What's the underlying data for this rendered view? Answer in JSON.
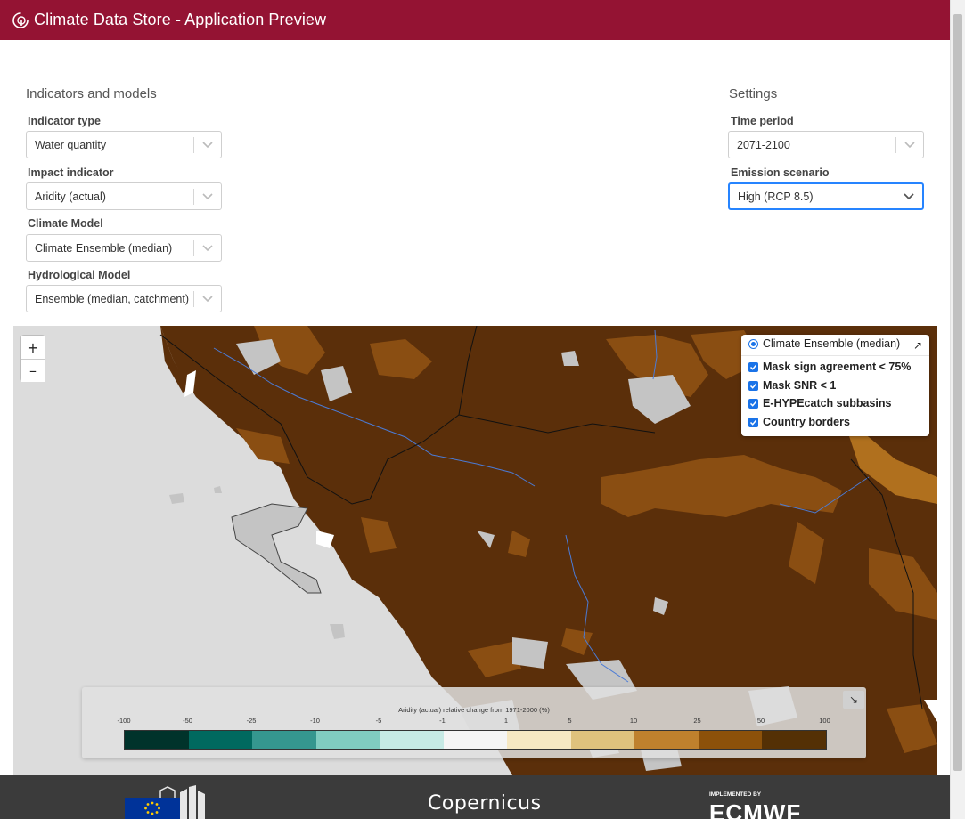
{
  "header": {
    "title": "Climate Data Store - Application Preview"
  },
  "indicators": {
    "section_title": "Indicators and models",
    "indicator_type": {
      "label": "Indicator type",
      "value": "Water quantity"
    },
    "impact_indicator": {
      "label": "Impact indicator",
      "value": "Aridity (actual)"
    },
    "climate_model": {
      "label": "Climate Model",
      "value": "Climate Ensemble (median)"
    },
    "hydrological_model": {
      "label": "Hydrological Model",
      "value": "Ensemble (median, catchment)"
    }
  },
  "settings": {
    "section_title": "Settings",
    "time_period": {
      "label": "Time period",
      "value": "2071-2100"
    },
    "emission_scenario": {
      "label": "Emission scenario",
      "value": "High (RCP 8.5)"
    }
  },
  "map": {
    "zoom_in": "+",
    "zoom_out": "–",
    "layers": {
      "base_layer": "Climate Ensemble (median)",
      "overlays": [
        {
          "label": "Mask sign agreement < 75%",
          "checked": true
        },
        {
          "label": "Mask SNR < 1",
          "checked": true
        },
        {
          "label": "E-HYPEcatch subbasins",
          "checked": true
        },
        {
          "label": "Country borders",
          "checked": true
        }
      ],
      "expand_icon": "↗"
    },
    "legend": {
      "title": "Aridity (actual) relative change from 1971-2000 (%)",
      "ticks": [
        "-100",
        "-50",
        "-25",
        "-10",
        "-5",
        "-1",
        "1",
        "5",
        "10",
        "25",
        "50",
        "100"
      ],
      "colors": [
        "#00332b",
        "#00695f",
        "#35978f",
        "#80cdc1",
        "#c7eae5",
        "#f5f5f5",
        "#f6e8c3",
        "#dfc27d",
        "#bf812d",
        "#8c510a",
        "#543005"
      ],
      "collapse_icon": "↘"
    },
    "colors": {
      "base": "#5b2f0a",
      "mid": "#8a4e12",
      "light": "#b0701e",
      "masked": "#c4c4c4",
      "sea": "#dcdcdc",
      "river": "#4b7bd6"
    }
  },
  "footer": {
    "copernicus": "Copernicus",
    "ecmwf_sub": "IMPLEMENTED BY",
    "ecmwf": "ECMWF"
  }
}
